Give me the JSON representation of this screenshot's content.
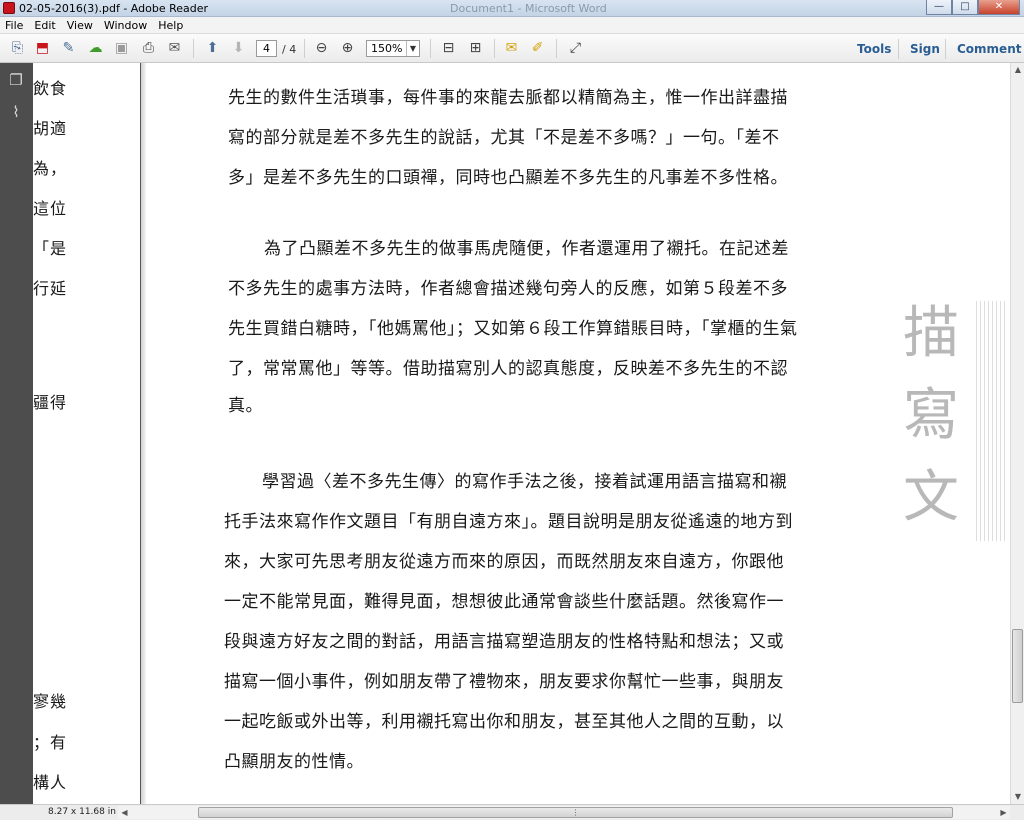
{
  "window": {
    "title": "02-05-2016(3).pdf - Adobe Reader",
    "background_title": "Document1 - Microsoft Word",
    "buttons": {
      "minimize": "—",
      "maximize": "□",
      "close": "✕"
    }
  },
  "menu": [
    "File",
    "Edit",
    "View",
    "Window",
    "Help"
  ],
  "toolbar": {
    "current_page": "4",
    "page_total": "/ 4",
    "zoom": "150%",
    "right_links": [
      "Tools",
      "Sign",
      "Comment"
    ]
  },
  "document": {
    "left_column_chars": [
      "飲食",
      "胡適",
      "為，",
      "這位",
      "「是",
      "行延",
      "疆得",
      "寥幾",
      "；有",
      "構人"
    ],
    "paragraph_1": [
      "先生的數件生活瑣事，每件事的來龍去脈都以精簡為主，惟一作出詳盡描",
      "寫的部分就是差不多先生的說話，尤其「不是差不多嗎？」一句。「差不",
      "多」是差不多先生的口頭禪，同時也凸顯差不多先生的凡事差不多性格。"
    ],
    "paragraph_2": [
      "為了凸顯差不多先生的做事馬虎隨便，作者還運用了襯托。在記述差",
      "不多先生的處事方法時，作者總會描述幾句旁人的反應，如第５段差不多",
      "先生買錯白糖時，「他媽罵他」；又如第６段工作算錯賬目時，「掌櫃的生氣",
      "了，常常罵他」等等。借助描寫別人的認真態度，反映差不多先生的不認",
      "真。"
    ],
    "paragraph_3": [
      "學習過〈差不多先生傳〉的寫作手法之後，接着試運用語言描寫和襯",
      "托手法來寫作作文題目「有朋自遠方來」。題目說明是朋友從遙遠的地方到",
      "來，大家可先思考朋友從遠方而來的原因，而既然朋友來自遠方，你跟他",
      "一定不能常見面，難得見面，想想彼此通常會談些什麼話題。然後寫作一",
      "段與遠方好友之間的對話，用語言描寫塑造朋友的性格特點和想法；又或",
      "描寫一個小事件，例如朋友帶了禮物來，朋友要求你幫忙一些事，與朋友",
      "一起吃飯或外出等，利用襯托寫出你和朋友，甚至其他人之間的互動，以",
      "凸顯朋友的性情。"
    ],
    "stamp_chars": [
      "描",
      "寫",
      "文"
    ]
  },
  "status": {
    "page_size": "8.27 x 11.68 in"
  }
}
